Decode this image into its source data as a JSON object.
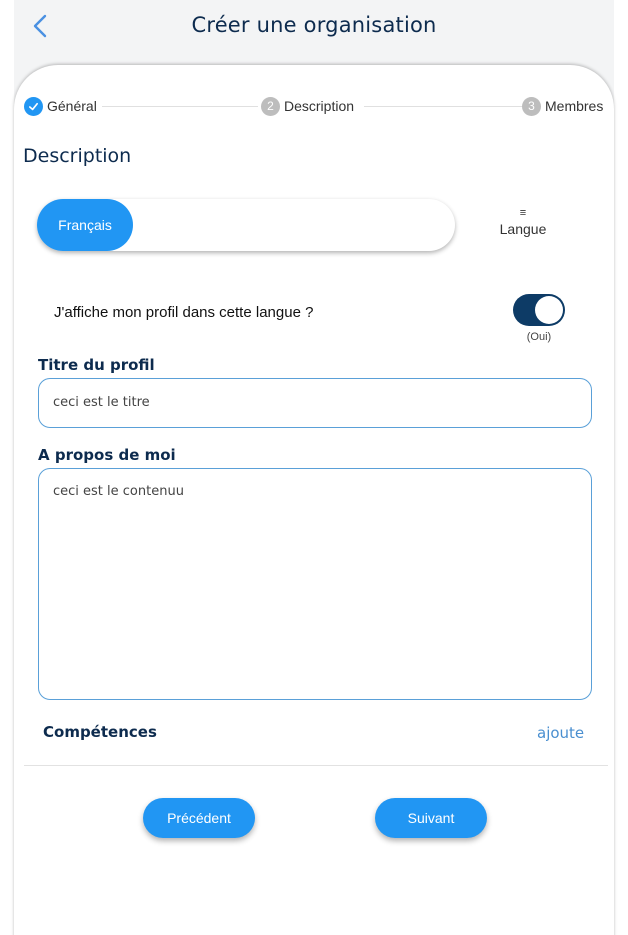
{
  "header": {
    "title": "Créer une organisation"
  },
  "stepper": {
    "steps": [
      {
        "number": "",
        "label": "Général",
        "state": "done"
      },
      {
        "number": "2",
        "label": "Description",
        "state": "todo"
      },
      {
        "number": "3",
        "label": "Membres",
        "state": "todo"
      }
    ]
  },
  "section": {
    "title": "Description"
  },
  "language": {
    "selected": "Français",
    "menu_icon": "≡",
    "menu_label": "Langue"
  },
  "visibility": {
    "question": "J'affiche mon profil dans cette langue ?",
    "enabled": true,
    "state_label": "(Oui)"
  },
  "profile_title": {
    "label": "Titre du profil",
    "value": "ceci est le titre"
  },
  "about": {
    "label": "A propos de moi",
    "value": "ceci est le contenuu"
  },
  "skills": {
    "label": "Compétences",
    "add_label": "ajoute"
  },
  "navigation": {
    "prev_label": "Précédent",
    "next_label": "Suivant"
  },
  "colors": {
    "accent": "#2196f3",
    "title": "#0d2b4e",
    "toggle_on": "#0d3b66"
  }
}
